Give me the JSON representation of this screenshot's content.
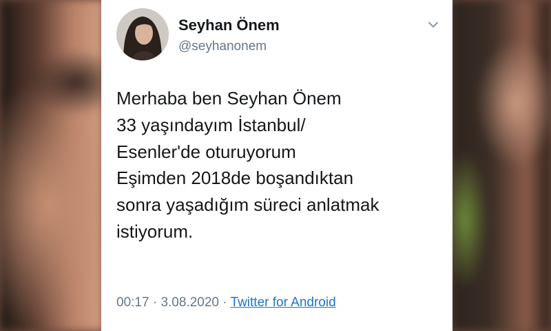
{
  "tweet": {
    "user_name": "Seyhan Önem",
    "user_handle": "@seyhanonem",
    "text_lines": [
      "Merhaba ben Seyhan Önem",
      "33 yaşındayım İstanbul/",
      "Esenler'de oturuyorum",
      "Eşimden 2018de boşandıktan",
      "sonra yaşadığım süreci anlatmak",
      "istiyorum."
    ],
    "time": "00:17",
    "separator": "·",
    "date": "3.08.2020",
    "source": "Twitter for Android",
    "icons": {
      "menu": "chevron-down-icon",
      "avatar": "profile-photo"
    },
    "colors": {
      "name": "#14171a",
      "secondary": "#657786",
      "link": "#1b74c8"
    }
  }
}
